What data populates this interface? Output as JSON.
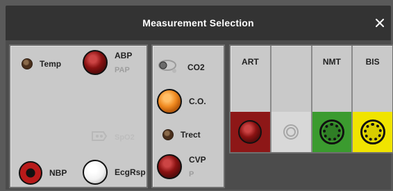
{
  "window": {
    "title": "Measurement Selection"
  },
  "panel1": {
    "temp": {
      "label": "Temp"
    },
    "abp": {
      "label": "ABP",
      "sub": "PAP"
    },
    "spo2": {
      "label": "SpO2"
    },
    "nbp": {
      "label": "NBP"
    },
    "ecgrsp": {
      "label": "EcgRsp"
    }
  },
  "panel2": {
    "co2": {
      "label": "CO2"
    },
    "co": {
      "label": "C.O."
    },
    "trect": {
      "label": "Trect"
    },
    "cvp": {
      "label": "CVP",
      "sub": "P"
    }
  },
  "panel3": {
    "columns": [
      {
        "label": "ART",
        "color": "#8d1717"
      },
      {
        "label": "",
        "color": "#d8d8d8"
      },
      {
        "label": "NMT",
        "color": "#3b9b2f"
      },
      {
        "label": "BIS",
        "color": "#f0e400"
      }
    ]
  },
  "icons": {
    "close": "close-icon",
    "temp": "temp-connector-icon",
    "abp": "abp-connector-icon",
    "spo2": "spo2-connector-icon",
    "nbp": "nbp-connector-icon",
    "ecg": "ecgrsp-connector-icon",
    "co2": "co2-connector-icon",
    "co": "co-connector-icon",
    "trect": "trect-connector-icon",
    "cvp": "cvp-connector-icon"
  }
}
